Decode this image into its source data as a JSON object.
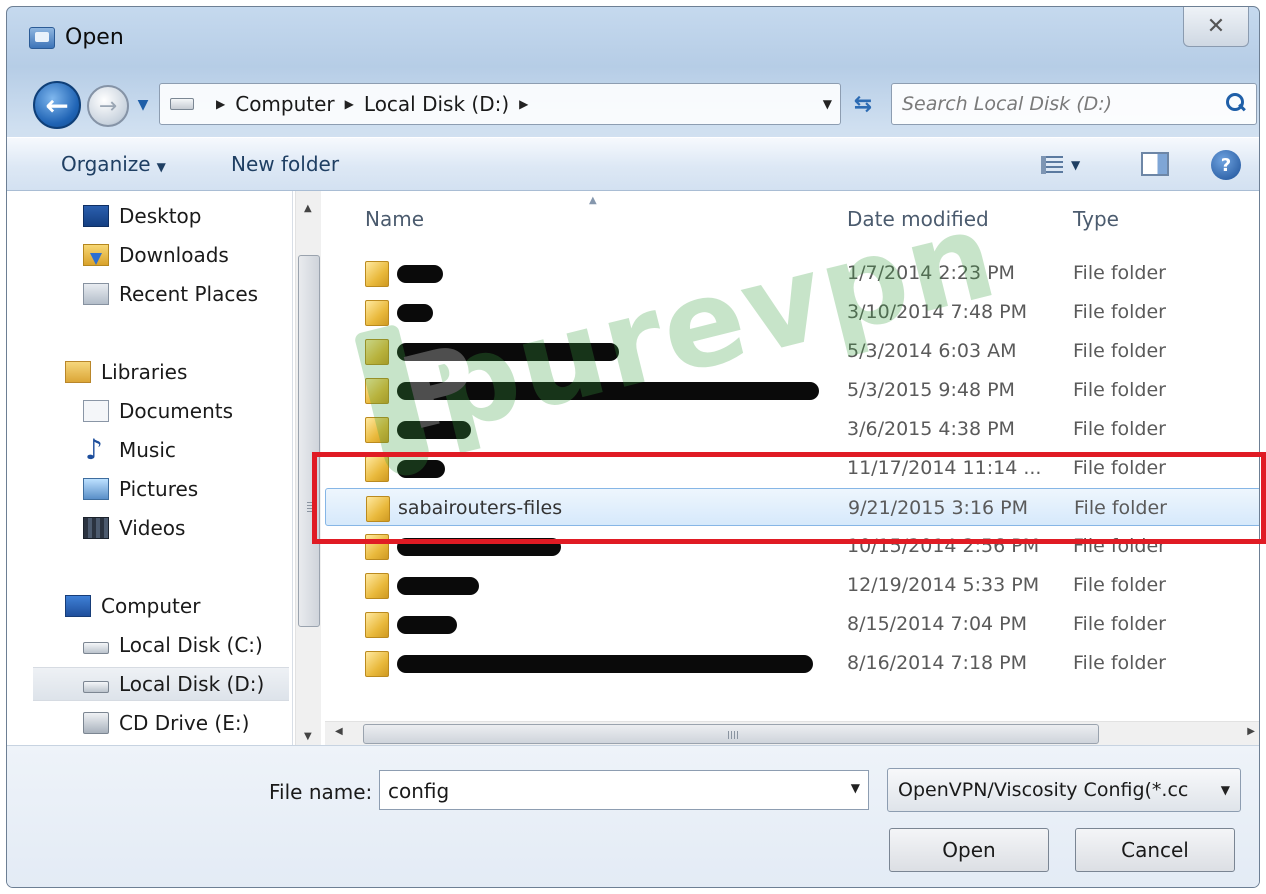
{
  "window": {
    "title": "Open",
    "close_glyph": "✕"
  },
  "nav": {
    "back_glyph": "←",
    "forward_glyph": "→",
    "breadcrumb": [
      "Computer",
      "Local Disk (D:)"
    ],
    "search_placeholder": "Search Local Disk (D:)"
  },
  "toolbar": {
    "organize_label": "Organize",
    "new_folder_label": "New folder",
    "help_glyph": "?"
  },
  "sidebar": {
    "items": [
      {
        "label": "Desktop",
        "icon": "desktop-icon"
      },
      {
        "label": "Downloads",
        "icon": "downloads-icon"
      },
      {
        "label": "Recent Places",
        "icon": "recent-places-icon"
      },
      {
        "label": "Libraries",
        "icon": "libraries-icon"
      },
      {
        "label": "Documents",
        "icon": "documents-icon"
      },
      {
        "label": "Music",
        "icon": "music-icon"
      },
      {
        "label": "Pictures",
        "icon": "pictures-icon"
      },
      {
        "label": "Videos",
        "icon": "videos-icon"
      },
      {
        "label": "Computer",
        "icon": "computer-icon"
      },
      {
        "label": "Local Disk (C:)",
        "icon": "drive-icon"
      },
      {
        "label": "Local Disk (D:)",
        "icon": "drive-icon",
        "selected": true
      },
      {
        "label": "CD Drive (E:)",
        "icon": "cd-drive-icon"
      }
    ]
  },
  "files": {
    "columns": {
      "name": "Name",
      "date": "Date modified",
      "type": "Type"
    },
    "rows": [
      {
        "name": "",
        "redacted": true,
        "date": "1/7/2014 2:23 PM",
        "type": "File folder"
      },
      {
        "name": "",
        "redacted": true,
        "date": "3/10/2014 7:48 PM",
        "type": "File folder"
      },
      {
        "name": "",
        "redacted": true,
        "date": "5/3/2014 6:03 AM",
        "type": "File folder"
      },
      {
        "name": "",
        "redacted": true,
        "date": "5/3/2015 9:48 PM",
        "type": "File folder"
      },
      {
        "name": "",
        "redacted": true,
        "date": "3/6/2015 4:38 PM",
        "type": "File folder"
      },
      {
        "name": "",
        "redacted": true,
        "date": "11/17/2014 11:14 ...",
        "type": "File folder"
      },
      {
        "name": "sabairouters-files",
        "redacted": false,
        "selected": true,
        "date": "9/21/2015 3:16 PM",
        "type": "File folder"
      },
      {
        "name": "",
        "redacted": true,
        "date": "10/15/2014 2:56 PM",
        "type": "File folder"
      },
      {
        "name": "",
        "redacted": true,
        "date": "12/19/2014 5:33 PM",
        "type": "File folder"
      },
      {
        "name": "",
        "redacted": true,
        "date": "8/15/2014 7:04 PM",
        "type": "File folder"
      },
      {
        "name": "",
        "redacted": true,
        "date": "8/16/2014 7:18 PM",
        "type": "File folder"
      }
    ]
  },
  "watermark": {
    "brand": "purevpn",
    "color": "#3aa040"
  },
  "highlight_color": "#e01b24",
  "bottom": {
    "file_name_label": "File name:",
    "file_name_value": "config",
    "filter_value": "OpenVPN/Viscosity Config(*.cc",
    "open_label": "Open",
    "cancel_label": "Cancel"
  }
}
